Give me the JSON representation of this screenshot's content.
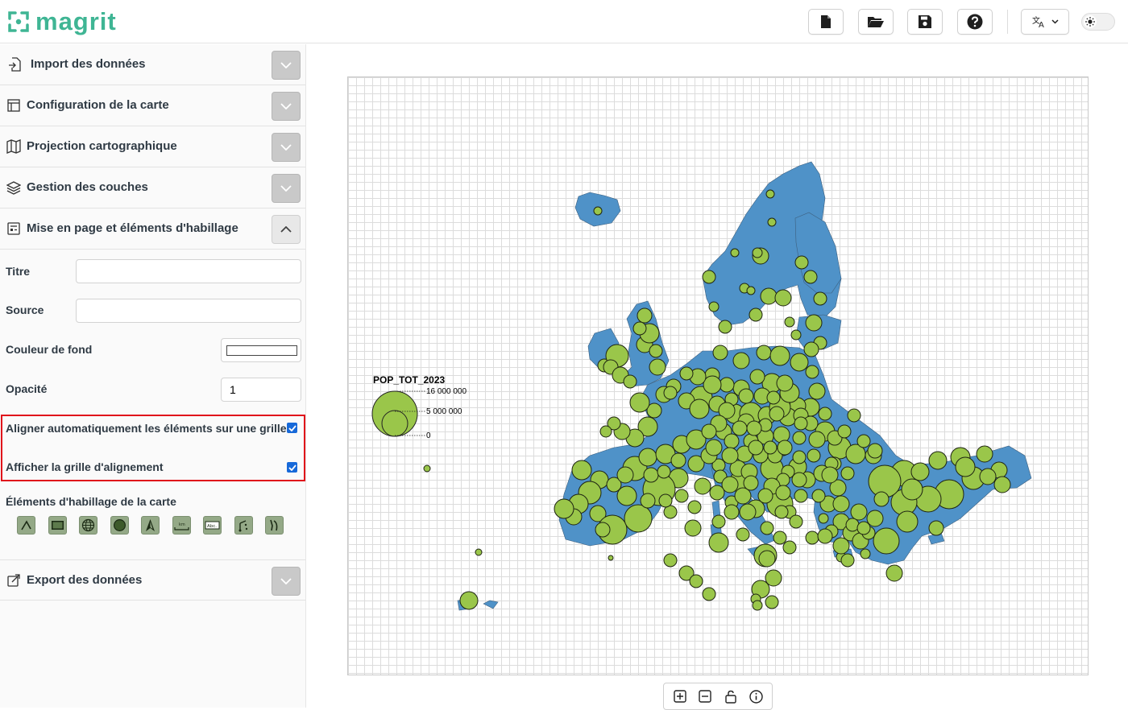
{
  "app": {
    "name": "magrit"
  },
  "colors": {
    "brand": "#3fb594",
    "highlight": "#e0101a",
    "symbol_fill": "#9ac64a",
    "land": "#4f92c8",
    "checkbox": "#1769d9"
  },
  "toolbar": {
    "new_icon": "new-file-icon",
    "open_icon": "folder-open-icon",
    "save_icon": "save-icon",
    "help_icon": "help-icon",
    "language_icon": "translate-icon",
    "theme_icon": "sun-icon"
  },
  "sidebar": {
    "sections": [
      {
        "label": "Import des données",
        "icon": "file-import-icon",
        "expanded": false
      },
      {
        "label": "Configuration de la carte",
        "icon": "map-config-icon",
        "expanded": false
      },
      {
        "label": "Projection cartographique",
        "icon": "map-icon",
        "expanded": false
      },
      {
        "label": "Gestion des couches",
        "icon": "layers-icon",
        "expanded": false
      },
      {
        "label": "Mise en page et éléments d'habillage",
        "icon": "layout-icon",
        "expanded": true
      },
      {
        "label": "Export des données",
        "icon": "export-icon",
        "expanded": false
      }
    ],
    "layout": {
      "title_label": "Titre",
      "title_value": "",
      "source_label": "Source",
      "source_value": "",
      "background_color_label": "Couleur de fond",
      "background_color": "#ffffff",
      "opacity_label": "Opacité",
      "opacity_value": "1",
      "snap_grid_label": "Aligner automatiquement les éléments sur une grille",
      "snap_grid_checked": true,
      "show_grid_label": "Afficher la grille d'alignement",
      "show_grid_checked": true,
      "elements_label": "Éléments d'habillage de la carte",
      "elements_icons": [
        "arrow-icon",
        "rectangle-icon",
        "graticule-icon",
        "circle-icon",
        "north-arrow-icon",
        "scale-bar-icon",
        "text-icon",
        "line-icon",
        "freehand-icon"
      ]
    }
  },
  "map": {
    "legend": {
      "title": "POP_TOT_2023",
      "values": [
        "16 000 000",
        "5 000 000",
        "0"
      ]
    }
  },
  "map_controls": {
    "zoom_in_icon": "zoom-in-icon",
    "zoom_out_icon": "zoom-out-icon",
    "lock_icon": "unlock-icon",
    "info_icon": "info-icon"
  }
}
